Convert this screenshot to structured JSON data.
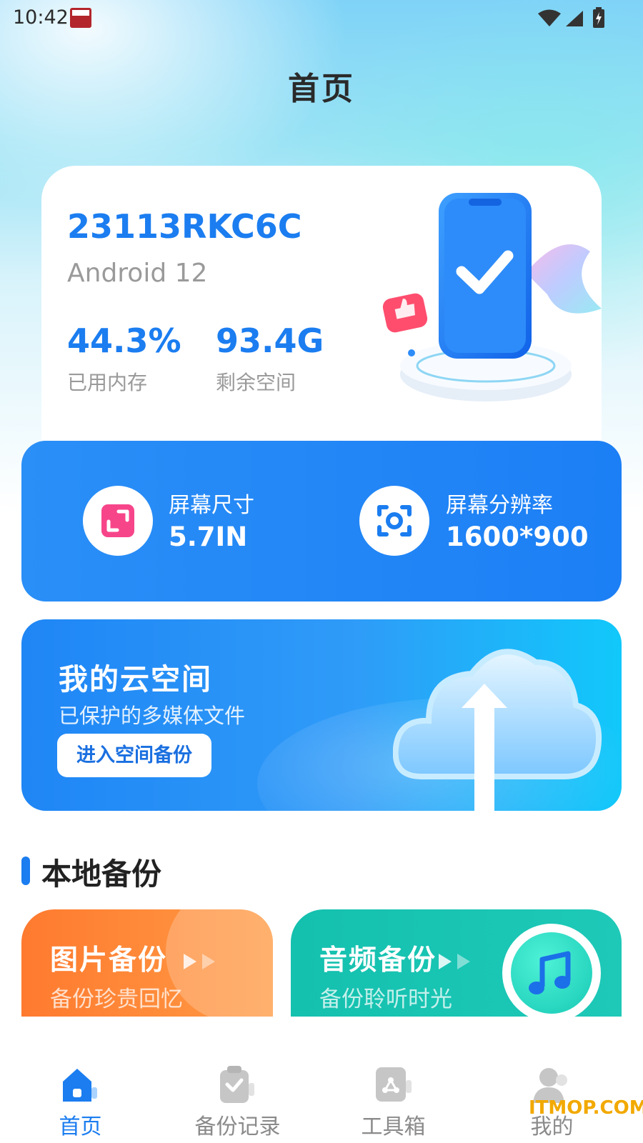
{
  "status_bar": {
    "time": "10:42"
  },
  "header": {
    "title": "首页"
  },
  "device": {
    "model": "23113RKC6C",
    "os": "Android 12",
    "stats": [
      {
        "value": "44.3%",
        "label": "已用内存"
      },
      {
        "value": "93.4G",
        "label": "剩余空间"
      }
    ]
  },
  "screen": {
    "items": [
      {
        "label": "屏幕尺寸",
        "value": "5.7IN",
        "icon": "resize-icon"
      },
      {
        "label": "屏幕分辨率",
        "value": "1600*900",
        "icon": "scan-icon"
      }
    ]
  },
  "cloud": {
    "title": "我的云空间",
    "subtitle": "已保护的多媒体文件",
    "button": "进入空间备份"
  },
  "local_backup": {
    "section_title": "本地备份",
    "cards": [
      {
        "title": "图片备份",
        "subtitle": "备份珍贵回忆",
        "color": "#ff8636"
      },
      {
        "title": "音频备份",
        "subtitle": "备份聆听时光",
        "color": "#17c4b1"
      }
    ]
  },
  "tabs": [
    {
      "label": "首页",
      "icon": "home-icon",
      "active": true
    },
    {
      "label": "备份记录",
      "icon": "clipboard-check-icon",
      "active": false
    },
    {
      "label": "工具箱",
      "icon": "toolbox-icon",
      "active": false
    },
    {
      "label": "我的",
      "icon": "user-icon",
      "active": false
    }
  ],
  "watermark": "ITMOP.COM",
  "colors": {
    "accent": "#1b7df0",
    "orange": "#ff8636",
    "teal": "#17c4b1"
  }
}
